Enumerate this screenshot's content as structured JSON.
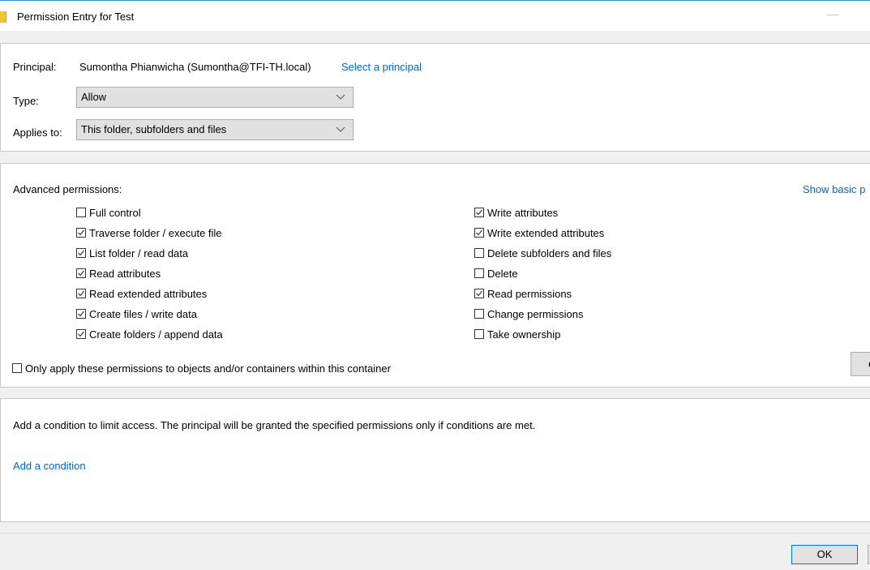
{
  "window": {
    "title": "Permission Entry for Test"
  },
  "principal": {
    "label": "Principal:",
    "value": "Sumontha Phianwicha (Sumontha@TFI-TH.local)",
    "select_link": "Select a principal"
  },
  "type": {
    "label": "Type:",
    "value": "Allow"
  },
  "applies_to": {
    "label": "Applies to:",
    "value": "This folder, subfolders and files"
  },
  "permissions": {
    "heading": "Advanced permissions:",
    "show_basic_link": "Show basic p",
    "left": [
      {
        "label": "Full control",
        "checked": false
      },
      {
        "label": "Traverse folder / execute file",
        "checked": true
      },
      {
        "label": "List folder / read data",
        "checked": true
      },
      {
        "label": "Read attributes",
        "checked": true
      },
      {
        "label": "Read extended attributes",
        "checked": true
      },
      {
        "label": "Create files / write data",
        "checked": true
      },
      {
        "label": "Create folders / append data",
        "checked": true
      }
    ],
    "right": [
      {
        "label": "Write attributes",
        "checked": true
      },
      {
        "label": "Write extended attributes",
        "checked": true
      },
      {
        "label": "Delete subfolders and files",
        "checked": false
      },
      {
        "label": "Delete",
        "checked": false
      },
      {
        "label": "Read permissions",
        "checked": true
      },
      {
        "label": "Change permissions",
        "checked": false
      },
      {
        "label": "Take ownership",
        "checked": false
      }
    ],
    "only_apply": {
      "label": "Only apply these permissions to objects and/or containers within this container",
      "checked": false
    },
    "clear_button": "C"
  },
  "condition": {
    "description": "Add a condition to limit access. The principal will be granted the specified permissions only if conditions are met.",
    "add_link": "Add a condition"
  },
  "footer": {
    "ok_label": "OK"
  },
  "colors": {
    "link": "#0066cc",
    "panel": "#ffffff",
    "background": "#f0f0f0",
    "accent": "#0078d7"
  }
}
